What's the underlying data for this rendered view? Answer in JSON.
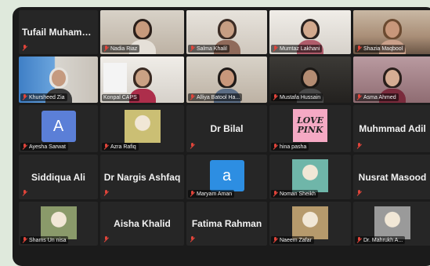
{
  "tiles": [
    {
      "name": "Tufail Muhamm...",
      "display": "name",
      "muted": true
    },
    {
      "name": "Nadia Riaz",
      "display": "video",
      "scene": "room-wall",
      "skin": "#c89a7c",
      "hair": "#2b1f1a",
      "shirt": "#e5e0d8",
      "muted": true
    },
    {
      "name": "Salma Khalil",
      "display": "video",
      "scene": "room-light",
      "skin": "#c79e83",
      "hair": "#3b2c25",
      "shirt": "#8f6a5a",
      "muted": true
    },
    {
      "name": "Mumtaz Lakhani",
      "display": "video",
      "scene": "room-office",
      "skin": "#d2a98e",
      "hair": "#2a2220",
      "shirt": "#b05c6b",
      "muted": true
    },
    {
      "name": "Shazia Maqbool",
      "display": "video",
      "scene": "room-warm",
      "skin": "#c8977a",
      "hair": "#6b4a30",
      "shirt": "#caa08a",
      "muted": true
    },
    {
      "name": "",
      "display": "video",
      "scene": "room-green",
      "skin": "#c8977a",
      "hair": "#3a2a20",
      "shirt": "#6e7a8a",
      "muted": false
    },
    {
      "name": "Khursheed Zia",
      "display": "video",
      "scene": "room-blue",
      "skin": "#c59a7f",
      "hair": "#e6e3de",
      "shirt": "#3b3b3b",
      "muted": true
    },
    {
      "name": "Konpal CAPS",
      "display": "video",
      "scene": "room-office",
      "skin": "#caa184",
      "hair": "#3a2a22",
      "shirt": "#ad2e4b",
      "muted": false,
      "active": true,
      "logo": "CAPS"
    },
    {
      "name": "Alliya Batool Ha...",
      "display": "video",
      "scene": "room-wall",
      "skin": "#c8977b",
      "hair": "#1f1a18",
      "shirt": "#5c6e86",
      "muted": true
    },
    {
      "name": "Mustafa Hussain",
      "display": "video",
      "scene": "room-dark",
      "skin": "#b48c72",
      "hair": "#1b1815",
      "shirt": "#4a4a4a",
      "muted": true
    },
    {
      "name": "Asma Ahmed",
      "display": "video",
      "scene": "room-pink",
      "skin": "#d6ad93",
      "hair": "#2a1f1b",
      "shirt": "#7a2b3c",
      "muted": true
    },
    {
      "name": "",
      "display": "name",
      "muted": false
    },
    {
      "name": "Ayesha Sarwat",
      "display": "avatar",
      "avatar_letter": "A",
      "avatar_color": "#5b7fd7",
      "muted": true
    },
    {
      "name": "Azra Rafiq",
      "display": "picture",
      "picture_color": "#cbbf74",
      "muted": true
    },
    {
      "name": "Dr Bilal",
      "display": "name",
      "muted": true
    },
    {
      "name": "hina pasha",
      "display": "lovepink",
      "text_line1": "LOVE",
      "text_line2": "PINK",
      "muted": true
    },
    {
      "name": "Muhmmad Adil",
      "display": "name",
      "muted": true
    },
    {
      "name": "",
      "display": "name",
      "muted": false
    },
    {
      "name": "Siddiqua Ali",
      "display": "name",
      "muted": true
    },
    {
      "name": "Dr Nargis Ashfaq",
      "display": "name",
      "muted": true
    },
    {
      "name": "Maryam Aman",
      "display": "avatar",
      "avatar_letter": "a",
      "avatar_color": "#2d8ee2",
      "muted": true
    },
    {
      "name": "Noman Sheikh",
      "display": "picture",
      "picture_color": "#6fb6a9",
      "muted": true
    },
    {
      "name": "Nusrat Masood",
      "display": "name",
      "muted": true
    },
    {
      "name": "",
      "display": "name",
      "muted": false
    },
    {
      "name": "Shams Un nisa",
      "display": "picture",
      "picture_color": "#8a9a6a",
      "muted": true
    },
    {
      "name": "Aisha Khalid",
      "display": "name",
      "muted": true
    },
    {
      "name": "Fatima Rahman",
      "display": "name",
      "muted": true
    },
    {
      "name": "Naeem Zafar",
      "display": "picture",
      "picture_color": "#b69a6c",
      "muted": true
    },
    {
      "name": "Dr. Mahrukh A...",
      "display": "picture",
      "picture_color": "#9a9a9a",
      "muted": true
    },
    {
      "name": "",
      "display": "name",
      "muted": false
    }
  ],
  "colors": {
    "tile_bg": "#262626",
    "active_border": "#e9d24a",
    "muted_icon": "#e0443a"
  }
}
